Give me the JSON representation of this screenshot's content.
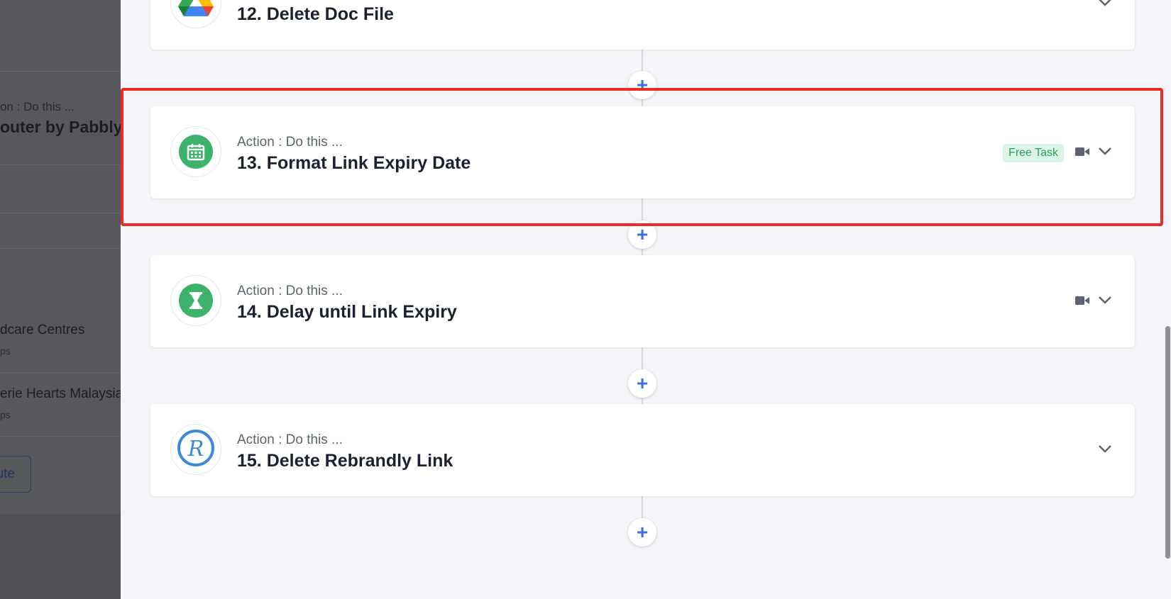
{
  "left_panel": {
    "action_label": "on : Do this ...",
    "router_title": "outer by Pabbly",
    "item1_name": "dcare Centres",
    "item1_sub": "ps",
    "item2_name": "erie Hearts Malaysia",
    "item2_sub": "ps",
    "button_label": "ute"
  },
  "steps": [
    {
      "kind": "Action : Do this ...",
      "title": "12. Delete Doc File",
      "icon": "google-drive-icon"
    },
    {
      "kind": "Action : Do this ...",
      "title": "13. Format Link Expiry Date",
      "icon": "calendar-icon",
      "badge": "Free Task"
    },
    {
      "kind": "Action : Do this ...",
      "title": "14. Delay until Link Expiry",
      "icon": "hourglass-icon"
    },
    {
      "kind": "Action : Do this ...",
      "title": "15. Delete Rebrandly Link",
      "icon": "rebrandly-icon"
    }
  ],
  "add_symbol": "+",
  "colors": {
    "accent_blue": "#3b6fe0",
    "highlight_red": "#ee2a24",
    "success_green": "#3db26b",
    "badge_bg": "#dcf5e6"
  }
}
